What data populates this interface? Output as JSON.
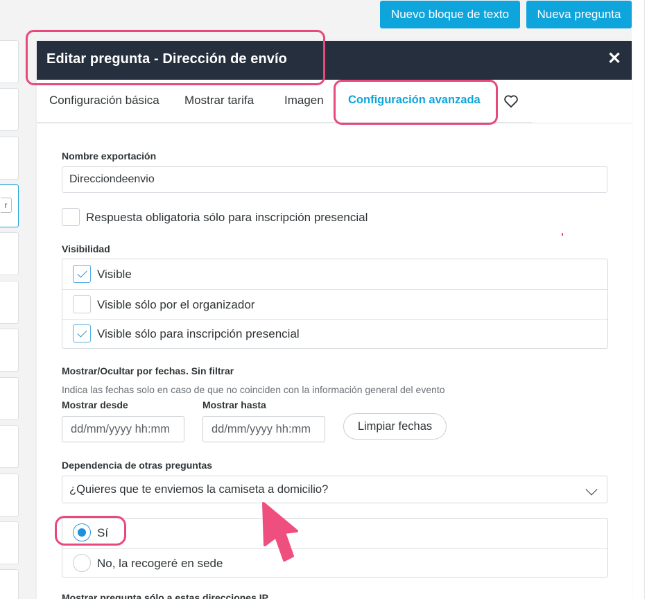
{
  "top_buttons": {
    "new_text_block": "Nuevo bloque de texto",
    "new_question": "Nueva pregunta"
  },
  "background": {
    "mini_button_label": "r"
  },
  "modal": {
    "title": "Editar pregunta - Dirección de envío",
    "close_label": "✕",
    "tabs": [
      {
        "label": "Configuración básica"
      },
      {
        "label": "Mostrar tarifa"
      },
      {
        "label": "Imagen"
      },
      {
        "label": "Configuración avanzada"
      }
    ],
    "favorite_icon": "heart-icon"
  },
  "form": {
    "export_name_label": "Nombre exportación",
    "export_name_value": "Direcciondeenvio",
    "mandatory_checkbox_label": "Respuesta obligatoria sólo para inscripción presencial",
    "mandatory_checked": false,
    "visibility_label": "Visibilidad",
    "visibility_options": [
      {
        "label": "Visible",
        "checked": true
      },
      {
        "label": "Visible sólo por el organizador",
        "checked": false
      },
      {
        "label": "Visible sólo para inscripción presencial",
        "checked": true
      }
    ],
    "dates_label": "Mostrar/Ocultar por fechas. Sin filtrar",
    "dates_hint": "Indica las fechas solo en caso de que no coinciden con la información general del evento",
    "show_from_label": "Mostrar desde",
    "show_until_label": "Mostrar hasta",
    "date_placeholder": "dd/mm/yyyy hh:mm",
    "clear_dates_button": "Limpiar fechas",
    "dependency_label": "Dependencia de otras preguntas",
    "dependency_selected": "¿Quieres que te enviemos la camiseta a domicilio?",
    "dependency_options": [
      {
        "label": "Sí",
        "selected": true
      },
      {
        "label": "No, la recogeré en sede",
        "selected": false
      }
    ],
    "ip_label": "Mostrar pregunta sólo a estas direcciones IP"
  },
  "colors": {
    "accent": "#0ea5dd",
    "header": "#252f3e",
    "highlight": "#e64a7b"
  }
}
